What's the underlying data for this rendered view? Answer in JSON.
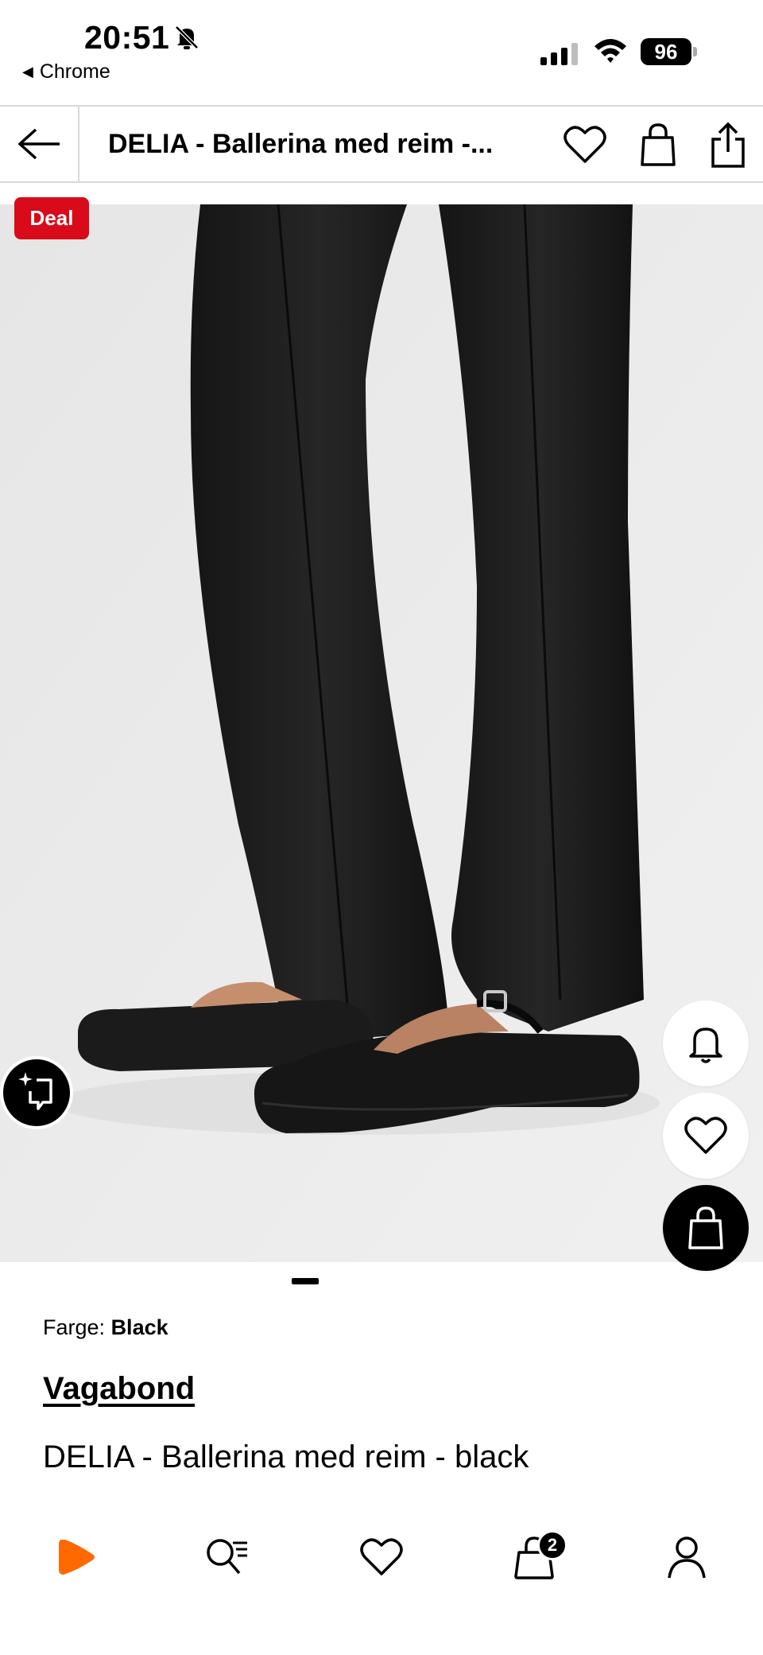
{
  "status_bar": {
    "time": "20:51",
    "back_app": "Chrome",
    "battery": "96"
  },
  "header": {
    "title": "DELIA - Ballerina med reim -..."
  },
  "product": {
    "deal_badge": "Deal",
    "color_label": "Farge:",
    "color_value": "Black",
    "brand": "Vagabond",
    "name": "DELIA - Ballerina med reim - black"
  },
  "bottom_nav": {
    "cart_count": "2"
  },
  "colors": {
    "accent": "#ff6900",
    "deal": "#d90a1a",
    "image_bg": "#ececec"
  }
}
